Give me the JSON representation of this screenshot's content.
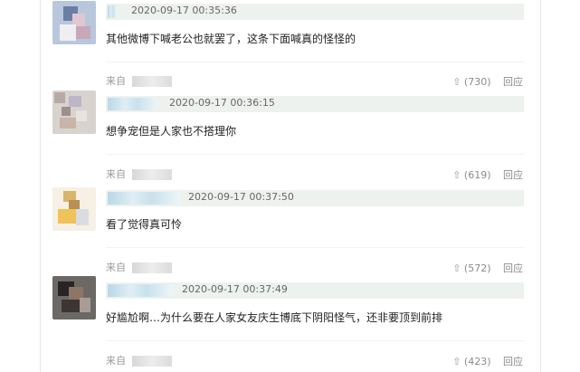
{
  "source_label": "来自",
  "like_icon": "like-icon",
  "reply_label": "回应",
  "comments": [
    {
      "timestamp": "2020-09-17 00:35:36",
      "text": "其他微博下喊老公也就罢了，这条下面喊真的怪怪的"
    },
    {
      "timestamp": "2020-09-17 00:36:15",
      "text": "想争宠但是人家也不搭理你",
      "likes": "(730)"
    },
    {
      "timestamp": "2020-09-17 00:37:50",
      "text": "看了觉得真可怜",
      "likes": "(619)"
    },
    {
      "timestamp": "2020-09-17 00:37:49",
      "text": "好尴尬啊…为什么要在人家女友庆生博底下阴阳怪气，还非要顶到前排",
      "likes": "(572)"
    }
  ],
  "last_footer": {
    "likes": "(423)"
  },
  "colors": {
    "like_icon": "#8a8a8a",
    "username_bar": "#edf2ef"
  }
}
